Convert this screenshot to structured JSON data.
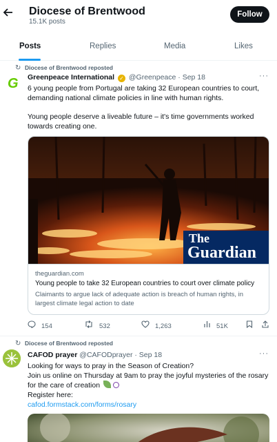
{
  "header": {
    "title": "Diocese of Brentwood",
    "subtitle": "15.1K posts",
    "follow_label": "Follow"
  },
  "tabs": [
    {
      "label": "Posts",
      "active": true
    },
    {
      "label": "Replies",
      "active": false
    },
    {
      "label": "Media",
      "active": false
    },
    {
      "label": "Likes",
      "active": false
    }
  ],
  "tweets": [
    {
      "repost_label": "Diocese of Brentwood reposted",
      "author_name": "Greenpeace International",
      "author_handle": "@Greenpeace",
      "date": "Sep 18",
      "text_1": "6 young people from Portugal are taking 32 European countries to court, demanding national climate policies in line with human rights.",
      "text_2": "Young people deserve a liveable future – it's time governments worked towards creating one.",
      "card": {
        "logo_line_1": "The",
        "logo_line_2": "Guardian",
        "domain": "theguardian.com",
        "title": "Young people to take 32 European countries to court over climate policy",
        "description": "Claimants to argue lack of adequate action is breach of human rights, in largest climate legal action to date"
      },
      "stats": {
        "replies": "154",
        "reposts": "532",
        "likes": "1,263",
        "views": "51K"
      }
    },
    {
      "repost_label": "Diocese of Brentwood reposted",
      "author_name": "CAFOD prayer",
      "author_handle": "@CAFODprayer",
      "date": "Sep 18",
      "text_1": "Looking for ways to pray in the Season of Creation?",
      "text_2": "Join us online on Thursday at 9am to pray the joyful mysteries of the rosary for the care of creation",
      "text_3": "Register here:",
      "link": "cafod.formstack.com/forms/rosary"
    }
  ],
  "icons": {
    "back": "arrow-left",
    "repost": "retweet",
    "reply": "speech-bubble",
    "like": "heart",
    "views": "bar-chart",
    "more": "ellipsis"
  },
  "colors": {
    "accent": "#1d9bf0",
    "text": "#0f1419",
    "muted": "#536471",
    "follow_bg": "#0f1419",
    "guardian_blue": "#052962",
    "greenpeace_green": "#66cc00"
  }
}
